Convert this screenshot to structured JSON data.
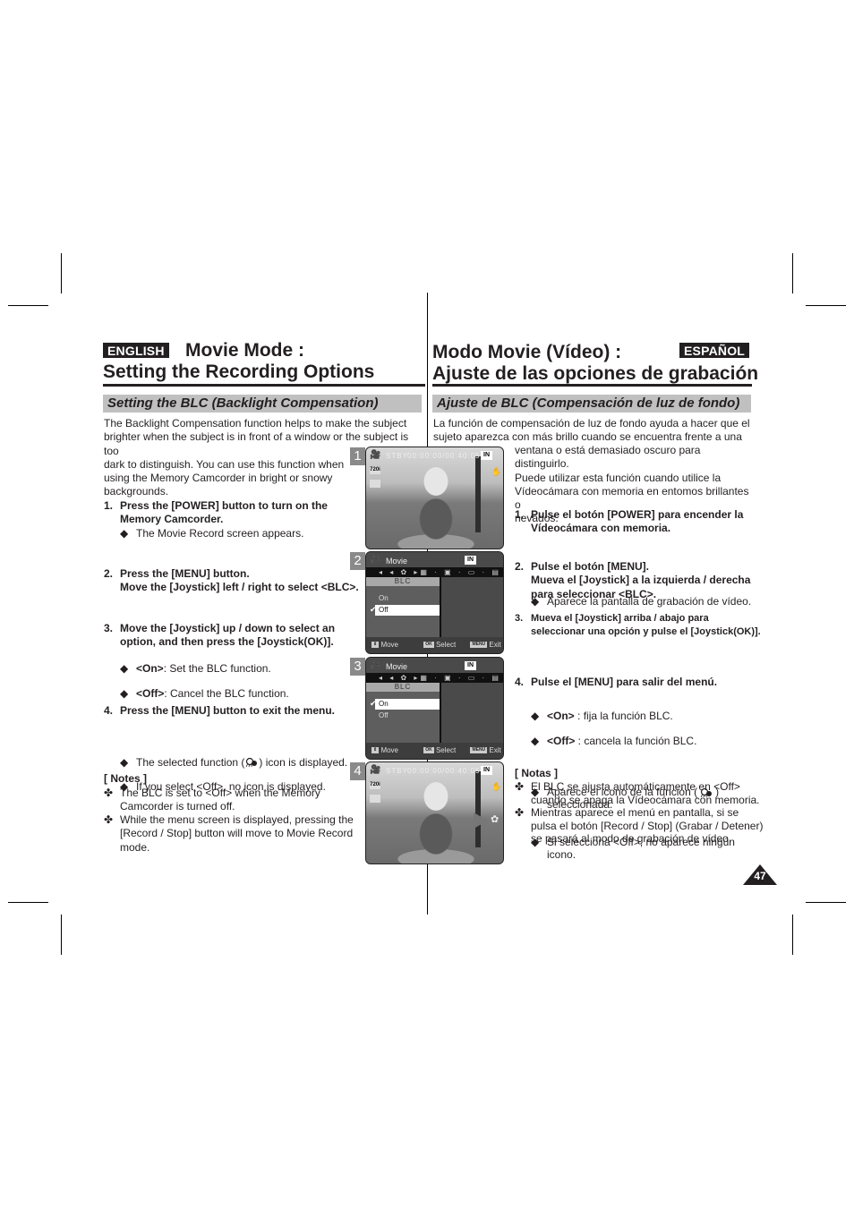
{
  "english": {
    "badge": "ENGLISH",
    "title_line1": "Movie Mode :",
    "title_line2": "Setting the Recording Options",
    "section": "Setting the BLC (Backlight Compensation)",
    "intro": [
      "The Backlight Compensation function helps to make the subject",
      "brighter when the subject is in front of a window or the subject is too",
      "dark to distinguish. You can use this function when",
      "using the Memory Camcorder in bright or snowy",
      "backgrounds."
    ],
    "steps": [
      {
        "num": "1.",
        "lines": [
          "Press the [POWER] button to turn on the",
          "Memory Camcorder."
        ],
        "bullets": [
          "The Movie Record screen appears."
        ]
      },
      {
        "num": "2.",
        "lines": [
          "Press the [MENU] button.",
          "Move the [Joystick] left / right to select <BLC>."
        ],
        "bullets": []
      },
      {
        "num": "3.",
        "lines": [
          "Move the [Joystick] up / down to select an",
          "option, and then press the [Joystick(OK)]."
        ],
        "bullets": [
          {
            "key": "<On>",
            "text": ": Set the BLC function."
          },
          {
            "key": "<Off>",
            "text": ": Cancel the BLC function."
          }
        ]
      },
      {
        "num": "4.",
        "lines": [
          "Press the [MENU] button to exit the menu."
        ],
        "bullets": [
          "The selected function (",
          ") icon is displayed.",
          "If you select <Off>, no icon is displayed."
        ]
      }
    ],
    "notes_title": "[ Notes ]",
    "notes": [
      [
        "The BLC is set to <Off> when the Memory",
        "Camcorder is turned off."
      ],
      [
        "While the menu screen is displayed, pressing the",
        "[Record / Stop] button will move to Movie Record",
        "mode."
      ]
    ]
  },
  "spanish": {
    "badge": "ESPAÑOL",
    "title_line1": "Modo Movie (Vídeo) :",
    "title_line2": "Ajuste de las opciones de grabación",
    "section": "Ajuste de BLC (Compensación de luz de fondo)",
    "intro": [
      "La función de compensación de luz de fondo ayuda a hacer que el",
      "sujeto aparezca con más brillo cuando se encuentra frente a una",
      "ventana o está demasiado oscuro para distinguirlo.",
      "Puede utilizar esta función cuando utilice la",
      "Vídeocámara con memoria en entomos brillantes o",
      "nevados."
    ],
    "steps": [
      {
        "num": "1.",
        "lines": [
          "Pulse el botón [POWER] para encender la",
          "Vídeocámara con memoria."
        ],
        "bullets": [
          "Aparece la pantalla de grabación de vídeo."
        ]
      },
      {
        "num": "2.",
        "lines": [
          "Pulse el botón [MENU].",
          "Mueva el [Joystick] a la izquierda / derecha",
          "para seleccionar <BLC>."
        ],
        "bullets": []
      },
      {
        "num": "3.",
        "lines": [
          "Mueva el [Joystick] arriba / abajo para",
          "seleccionar una opción y pulse el [Joystick(OK)]."
        ],
        "bullets": [
          {
            "key": "<On>",
            "text": " : fija la función BLC."
          },
          {
            "key": "<Off>",
            "text": " : cancela la función BLC."
          }
        ]
      },
      {
        "num": "4.",
        "lines": [
          "Pulse el [MENU] para salir del menú."
        ],
        "bullets": [
          "Aparece el icono de la función (",
          ")",
          "seleccionada.",
          "Si selecciona <Off>, no aparece ningún",
          "icono."
        ]
      }
    ],
    "notes_title": "[ Notas ]",
    "notes": [
      [
        "El BLC se ajusta automáticamente en <Off>",
        "cuando se apaga la Vídeocámara con memoria."
      ],
      [
        "Mientras aparece el menú en pantalla, si se",
        "pulsa el botón [Record / Stop] (Grabar / Detener)",
        "se pasará al modo de grabación de vídeo."
      ]
    ]
  },
  "screens": [
    {
      "num": "1",
      "type": "record",
      "status": "STBY",
      "timecode": "00:00:00/00:40:05",
      "memory": "IN",
      "quality": "720i"
    },
    {
      "num": "2",
      "type": "menu",
      "menu_title": "Movie",
      "submenu": "BLC",
      "options": [
        "On",
        "Off"
      ],
      "selected": "Off",
      "footer": {
        "move": "Move",
        "select": "Select",
        "exit": "Exit",
        "ok_key": "OK",
        "menu_key": "MENU"
      },
      "memory": "IN"
    },
    {
      "num": "3",
      "type": "menu",
      "menu_title": "Movie",
      "submenu": "BLC",
      "options": [
        "On",
        "Off"
      ],
      "selected": "On",
      "footer": {
        "move": "Move",
        "select": "Select",
        "exit": "Exit",
        "ok_key": "OK",
        "menu_key": "MENU"
      },
      "memory": "IN"
    },
    {
      "num": "4",
      "type": "record",
      "status": "STBY",
      "timecode": "00:00:00/00:40:05",
      "memory": "IN",
      "quality": "720i",
      "blc_icon": true
    }
  ],
  "page_number": "47",
  "symbols": {
    "bullet": "◆",
    "note": "✤",
    "check": "✔",
    "blc_icon": "blc-icon"
  }
}
